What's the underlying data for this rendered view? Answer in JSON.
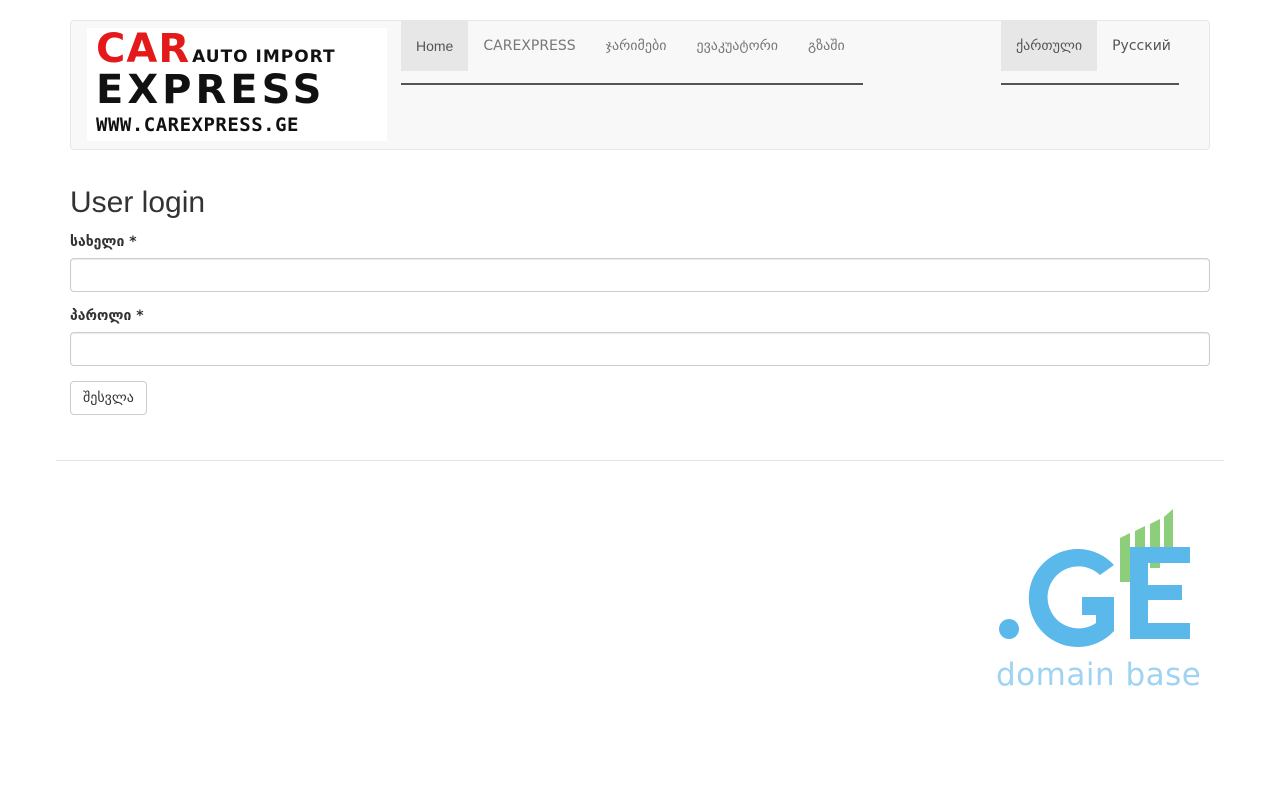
{
  "site": {
    "logo": {
      "line1_brand": "CAR",
      "line1_tagline": "AUTO IMPORT",
      "line2": "EXPRESS",
      "line3": "WWW.CAREXPRESS.GE"
    }
  },
  "nav": {
    "items": [
      {
        "label": "Home",
        "active": true
      },
      {
        "label": "CAREXPRESS",
        "active": false
      },
      {
        "label": "ჯარიმები",
        "active": false
      },
      {
        "label": "ევაკუატორი",
        "active": false
      },
      {
        "label": "გზაში",
        "active": false
      }
    ],
    "languages": [
      {
        "label": "ქართული",
        "active": true
      },
      {
        "label": "Русский",
        "active": false
      }
    ]
  },
  "login": {
    "title": "User login",
    "username_label": "სახელი",
    "password_label": "პაროლი",
    "required_marker": "*",
    "username_value": "",
    "password_value": "",
    "submit_label": "შესვლა"
  },
  "footer": {
    "badge_text": "domain base"
  },
  "colors": {
    "logo_red": "#e41a1a",
    "domain_blue": "#5bb8ea",
    "domain_green": "#8dce7a",
    "domain_text": "#9fd3f1"
  },
  "icons": {
    "footer_badge": "ge-domain-logo-icon"
  }
}
